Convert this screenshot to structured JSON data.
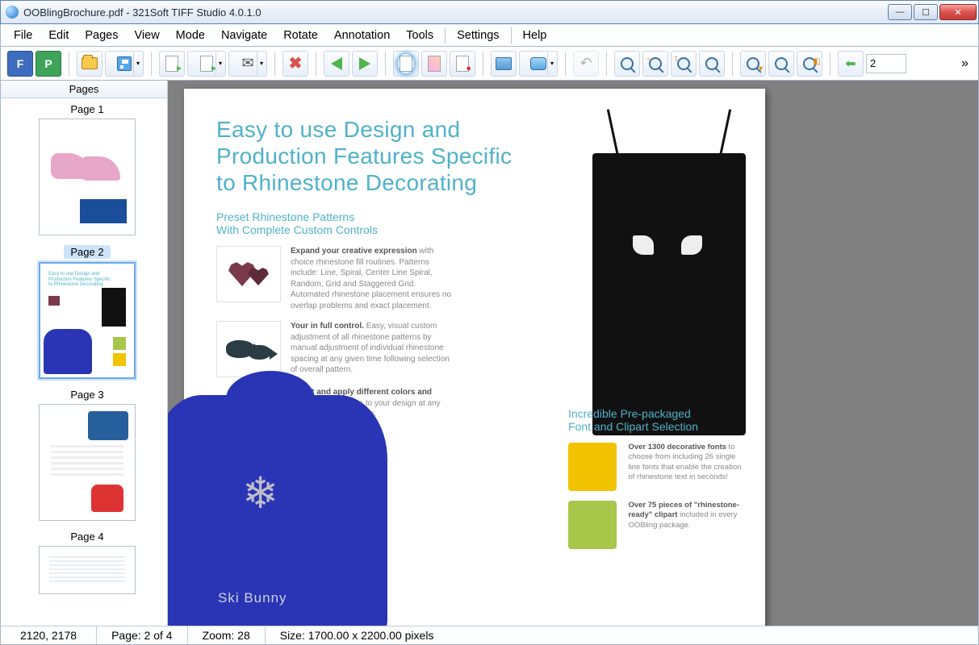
{
  "title": "OOBlingBrochure.pdf - 321Soft TIFF Studio 4.0.1.0",
  "menu": [
    "File",
    "Edit",
    "Pages",
    "View",
    "Mode",
    "Navigate",
    "Rotate",
    "Annotation",
    "Tools",
    "Settings",
    "Help"
  ],
  "toolbar": {
    "letter_f": "F",
    "letter_p": "P",
    "page_value": "2"
  },
  "sidebar": {
    "title": "Pages",
    "items": [
      {
        "label": "Page 1",
        "selected": false
      },
      {
        "label": "Page 2",
        "selected": true
      },
      {
        "label": "Page 3",
        "selected": false
      },
      {
        "label": "Page 4",
        "selected": false
      }
    ]
  },
  "document": {
    "heading_line1": "Easy to use Design and",
    "heading_line2": "Production Features Specific",
    "heading_line3": "to Rhinestone Decorating",
    "sub1_line1": "Preset Rhinestone Patterns",
    "sub1_line2": "With Complete Custom Controls",
    "feat1_bold": "Expand your creative expression",
    "feat1_rest": " with choice rhinestone fill routines. Patterns include: Line, Spiral, Center Line Spiral, Random, Grid and Staggered Grid. Automated rhinestone placement ensures no overlap problems and exact placement.",
    "feat2_bold": "Your in full control.",
    "feat2_rest": " Easy, visual custom adjustment of all rhinestone patterns by manual adjustment of individual rhinestone spacing at any given time following selection of overall pattern.",
    "feat3_bold": "Select and apply different colors and sizes",
    "feat3_rest": " of rhinestones to your design at any time during the process.",
    "hoodie_text": "Ski Bunny",
    "sub2_line1": "Incredible Pre-packaged",
    "sub2_line2": "Font and Clipart Selection",
    "block1_bold": "Over 1300 decorative fonts",
    "block1_rest": " to choose from including 26 single line fonts that enable the creation of rhinestone text in seconds!",
    "block2_bold": "Over 75 pieces of \"rhinestone-ready\" clipart",
    "block2_rest": " included in every OOBling package."
  },
  "status": {
    "coords": "2120, 2178",
    "page": "Page: 2 of 4",
    "zoom": "Zoom: 28",
    "size": "Size: 1700.00 x 2200.00 pixels"
  }
}
